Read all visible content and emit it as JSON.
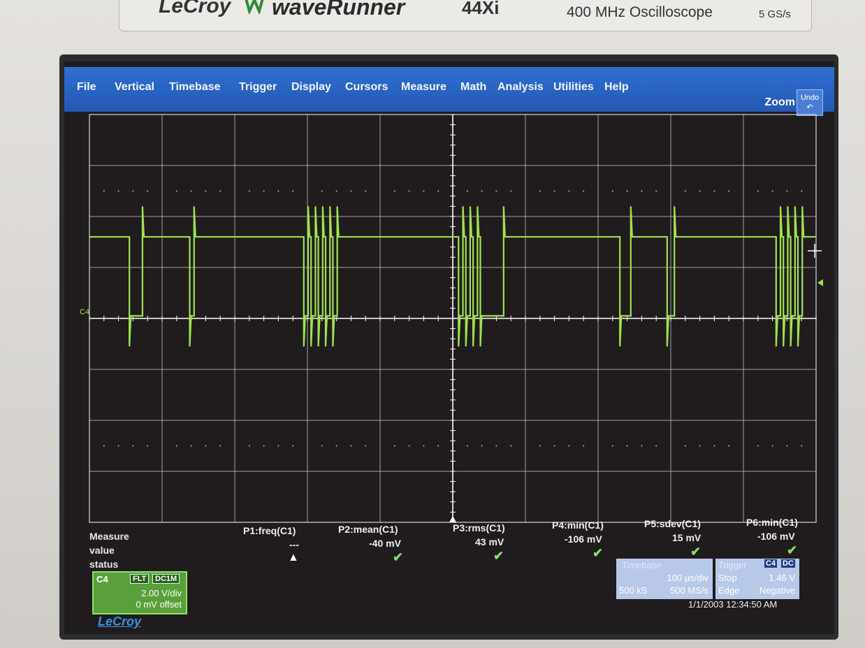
{
  "brand": {
    "maker": "LeCroy",
    "series": "waveRunner",
    "model": "44Xi",
    "description": "400 MHz Oscilloscope",
    "sample_rate": "5 GS/s"
  },
  "menu": {
    "items": [
      "File",
      "Vertical",
      "Timebase",
      "Trigger",
      "Display",
      "Cursors",
      "Measure",
      "Math",
      "Analysis",
      "Utilities",
      "Help"
    ],
    "zoom_label": "Zoom",
    "undo_label": "Undo"
  },
  "channel": {
    "marker": "C4",
    "box_label": "C4",
    "badge_flt": "FLT",
    "badge_coupling": "DC1M",
    "vdiv": "2.00 V/div",
    "offset": "0 mV offset",
    "color": "#9fe34f"
  },
  "measure": {
    "row_labels": [
      "Measure",
      "value",
      "status"
    ],
    "params": [
      {
        "name": "P1:freq(C1)",
        "value": "---",
        "status": "warning"
      },
      {
        "name": "P2:mean(C1)",
        "value": "-40 mV",
        "status": "ok"
      },
      {
        "name": "P3:rms(C1)",
        "value": "43 mV",
        "status": "ok"
      },
      {
        "name": "P4:min(C1)",
        "value": "-106 mV",
        "status": "ok"
      },
      {
        "name": "P5:sdev(C1)",
        "value": "15 mV",
        "status": "ok"
      },
      {
        "name": "P6:min(C1)",
        "value": "-106 mV",
        "status": "ok"
      }
    ]
  },
  "timebase": {
    "label": "Timebase",
    "time_div": "100 µs/div",
    "samples": "500 kS",
    "rate": "500 MS/s"
  },
  "trigger": {
    "label": "Trigger",
    "source_badge": "C4",
    "coupling_badge": "DC",
    "mode": "Stop",
    "level": "1.46 V",
    "type": "Edge",
    "slope": "Negative"
  },
  "footer": {
    "logo": "LeCroy",
    "datetime": "1/1/2003 12:34:50 AM"
  },
  "waveform": {
    "description_levels": {
      "high_div": 1.6,
      "low_div": 0.05
    },
    "pulses": [
      {
        "t": 0.55,
        "w": 0.18
      },
      {
        "t": 1.38,
        "w": 0.06
      },
      {
        "t": 2.95,
        "w": 0.06
      },
      {
        "t": 3.05,
        "w": 0.06
      },
      {
        "t": 3.15,
        "w": 0.06
      },
      {
        "t": 3.25,
        "w": 0.06
      },
      {
        "t": 3.35,
        "w": 0.06
      },
      {
        "t": 5.08,
        "w": 0.06
      },
      {
        "t": 5.18,
        "w": 0.06
      },
      {
        "t": 5.28,
        "w": 0.06
      },
      {
        "t": 5.38,
        "w": 0.32
      },
      {
        "t": 7.3,
        "w": 0.15
      },
      {
        "t": 7.95,
        "w": 0.1
      },
      {
        "t": 9.45,
        "w": 0.06
      },
      {
        "t": 9.55,
        "w": 0.06
      },
      {
        "t": 9.65,
        "w": 0.06
      },
      {
        "t": 9.75,
        "w": 0.06
      }
    ]
  }
}
